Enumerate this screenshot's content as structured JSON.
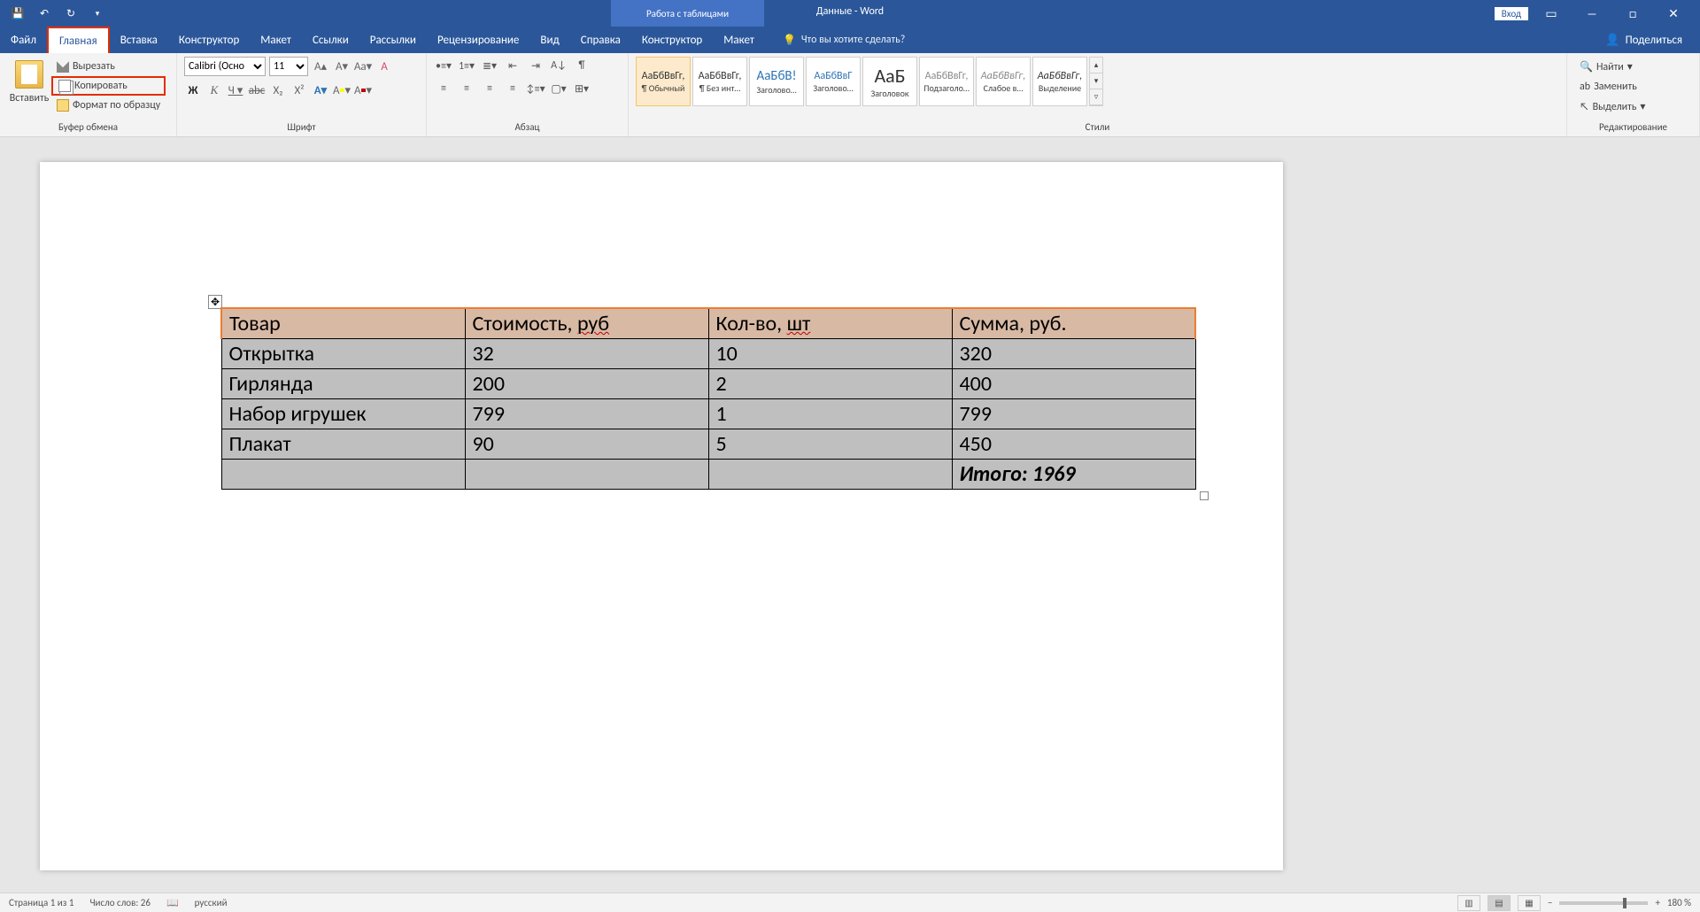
{
  "title": "Данные - Word",
  "tooltabs": "Работа с таблицами",
  "signin": "Вход",
  "tabs": [
    "Файл",
    "Главная",
    "Вставка",
    "Конструктор",
    "Макет",
    "Ссылки",
    "Рассылки",
    "Рецензирование",
    "Вид",
    "Справка",
    "Конструктор",
    "Макет"
  ],
  "tellme": "Что вы хотите сделать?",
  "share": "Поделиться",
  "clipboard": {
    "paste": "Вставить",
    "cut": "Вырезать",
    "copy": "Копировать",
    "format": "Формат по образцу",
    "group": "Буфер обмена"
  },
  "font": {
    "name": "Calibri (Осно",
    "size": "11",
    "group": "Шрифт"
  },
  "para": {
    "group": "Абзац"
  },
  "styles": {
    "group": "Стили",
    "items": [
      {
        "preview": "АаБбВвГг,",
        "label": "¶ Обычный"
      },
      {
        "preview": "АаБбВвГг,",
        "label": "¶ Без инт…"
      },
      {
        "preview": "АаБбВ!",
        "label": "Заголово…"
      },
      {
        "preview": "АаБбВвГ",
        "label": "Заголово…"
      },
      {
        "preview": "АаБ",
        "label": "Заголовок"
      },
      {
        "preview": "АаБбВвГг,",
        "label": "Подзаголо…"
      },
      {
        "preview": "АаБбВвГг,",
        "label": "Слабое в…"
      },
      {
        "preview": "АаБбВвГг,",
        "label": "Выделение"
      }
    ]
  },
  "editing": {
    "find": "Найти",
    "replace": "Заменить",
    "select": "Выделить",
    "group": "Редактирование"
  },
  "table": {
    "headers": [
      "Товар",
      "Стоимость, руб",
      "Кол-во, шт",
      "Сумма, руб."
    ],
    "rows": [
      [
        "Открытка",
        "32",
        "10",
        "320"
      ],
      [
        "Гирлянда",
        "200",
        "2",
        "400"
      ],
      [
        "Набор игрушек",
        "799",
        "1",
        "799"
      ],
      [
        "Плакат",
        "90",
        "5",
        "450"
      ]
    ],
    "total": "Итого: 1969"
  },
  "status": {
    "page": "Страница 1 из 1",
    "words": "Число слов: 26",
    "lang": "русский",
    "zoom": "180 %"
  }
}
